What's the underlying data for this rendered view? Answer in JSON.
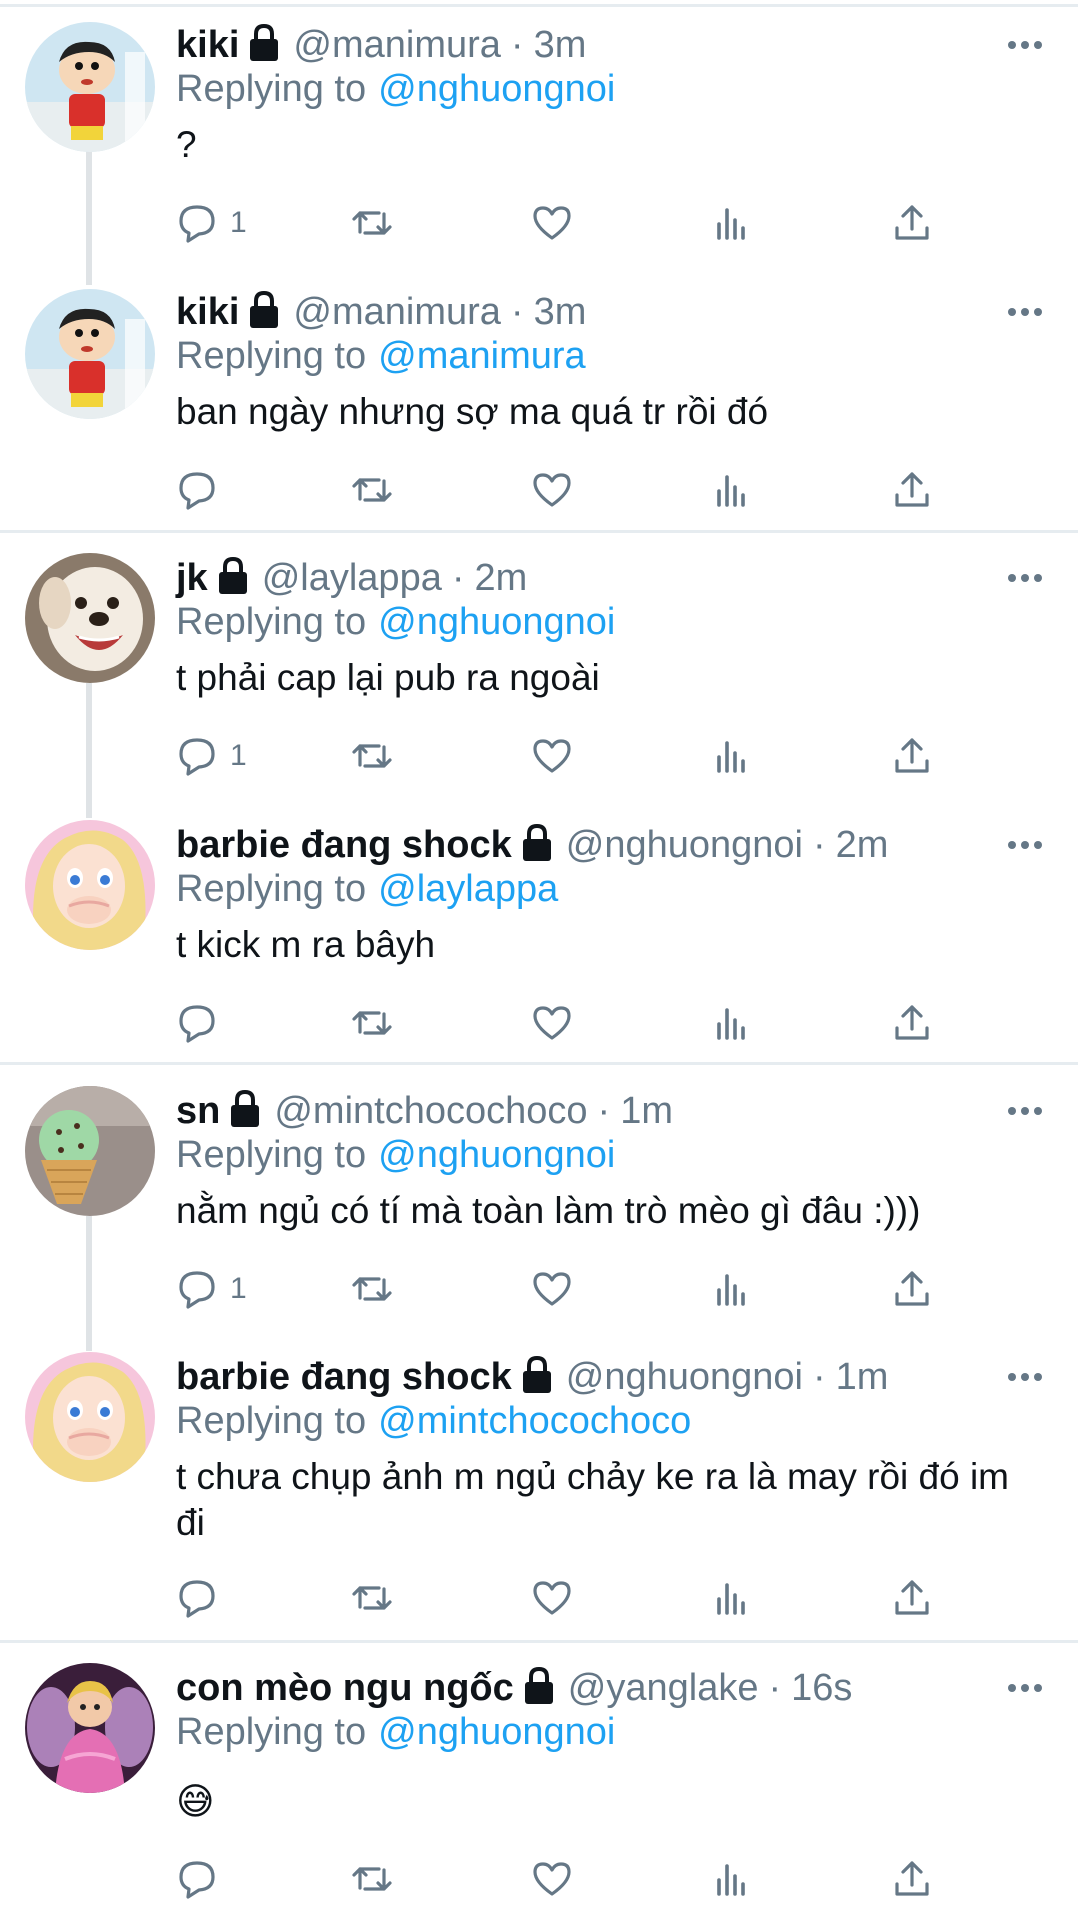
{
  "colors": {
    "accent": "#1da1f2",
    "secondary_text": "#657786",
    "primary_text": "#0f1419",
    "divider": "#e6ecf0",
    "thread_line": "#dfe3e6"
  },
  "tweets": [
    {
      "name": "kiki",
      "handle": "@manimura",
      "time": "3m",
      "reply_prefix": "Replying to",
      "reply_to": "@nghuongnoi",
      "text": "?",
      "reply_count": "1",
      "avatar": "cartoon-boy-avatar"
    },
    {
      "name": "kiki",
      "handle": "@manimura",
      "time": "3m",
      "reply_prefix": "Replying to",
      "reply_to": "@manimura",
      "text": "ban ngày nhưng sợ ma quá tr rồi đó",
      "reply_count": "",
      "avatar": "cartoon-boy-avatar"
    },
    {
      "name": "jk",
      "handle": "@laylappa",
      "time": "2m",
      "reply_prefix": "Replying to",
      "reply_to": "@nghuongnoi",
      "text": "t phải cap lại pub ra ngoài",
      "reply_count": "1",
      "avatar": "dog-avatar"
    },
    {
      "name": "barbie đang shock",
      "handle": "@nghuongnoi",
      "time": "2m",
      "reply_prefix": "Replying to",
      "reply_to": "@laylappa",
      "text": "t kick m ra bâyh",
      "reply_count": "",
      "avatar": "barbie-avatar"
    },
    {
      "name": "sn",
      "handle": "@mintchocochoco",
      "time": "1m",
      "reply_prefix": "Replying to",
      "reply_to": "@nghuongnoi",
      "text": "nằm ngủ có tí mà toàn làm trò mèo gì đâu :)))",
      "reply_count": "1",
      "avatar": "ice-cream-avatar"
    },
    {
      "name": "barbie đang shock",
      "handle": "@nghuongnoi",
      "time": "1m",
      "reply_prefix": "Replying to",
      "reply_to": "@mintchocochoco",
      "text": "t chưa chụp ảnh m ngủ chảy ke ra là may rồi đó im đi",
      "reply_count": "",
      "avatar": "barbie-avatar"
    },
    {
      "name": "con mèo ngu ngốc",
      "handle": "@yanglake",
      "time": "16s",
      "reply_prefix": "Replying to",
      "reply_to": "@nghuongnoi",
      "text": "😅",
      "reply_count": "",
      "avatar": "fairy-cartoon-avatar"
    }
  ]
}
